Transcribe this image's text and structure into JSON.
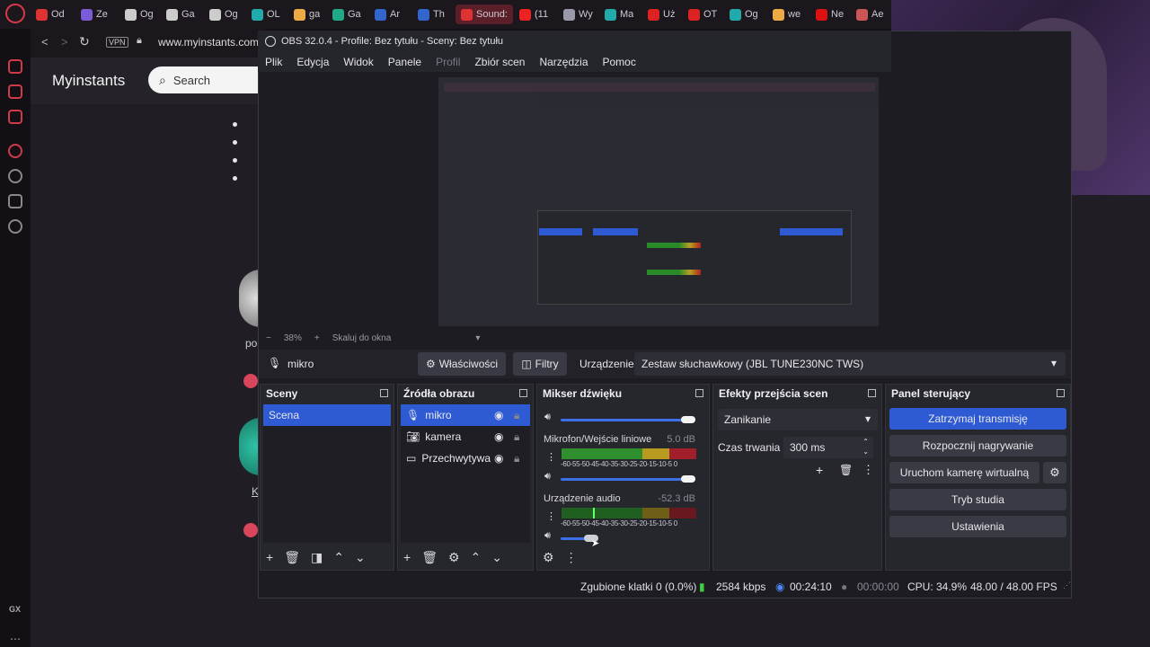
{
  "browser": {
    "tabs": [
      {
        "label": "Od",
        "color": "#d33"
      },
      {
        "label": "Ze",
        "color": "#7b5bd6"
      },
      {
        "label": "Og",
        "color": "#ccc"
      },
      {
        "label": "Ga",
        "color": "#ccc"
      },
      {
        "label": "Og",
        "color": "#ccc"
      },
      {
        "label": "OL",
        "color": "#2aa"
      },
      {
        "label": "ga",
        "color": "#ea4"
      },
      {
        "label": "Ga",
        "color": "#2a8"
      },
      {
        "label": "Ar",
        "color": "#36c"
      },
      {
        "label": "Th",
        "color": "#36c"
      },
      {
        "label": "Sound:",
        "color": "#d33"
      },
      {
        "label": "(11",
        "color": "#e22"
      },
      {
        "label": "Wy",
        "color": "#99a"
      },
      {
        "label": "Ma",
        "color": "#2aa"
      },
      {
        "label": "Uż",
        "color": "#d22"
      },
      {
        "label": "OT",
        "color": "#d22"
      },
      {
        "label": "Og",
        "color": "#2aa"
      },
      {
        "label": "we",
        "color": "#ea4"
      },
      {
        "label": "Ne",
        "color": "#d11"
      },
      {
        "label": "Ae",
        "color": "#c55"
      }
    ],
    "vpn_label": "VPN",
    "url": "www.myinstants.com/",
    "gx_label": "GX"
  },
  "site": {
    "name": "Myinstants",
    "search_placeholder": "Search",
    "partial_label_1": "po",
    "partial_label_2": "K"
  },
  "obs": {
    "title": "OBS 32.0.4 - Profile: Bez tytułu - Sceny: Bez tytułu",
    "menu": [
      "Plik",
      "Edycja",
      "Widok",
      "Panele",
      "Profil",
      "Zbiór scen",
      "Narzędzia",
      "Pomoc"
    ],
    "zoom": "38%",
    "scale_label": "Skaluj do okna",
    "source_bar": {
      "source_name": "mikro",
      "properties_label": "Właściwości",
      "filters_label": "Filtry",
      "device_label": "Urządzenie",
      "device_value": "Zestaw słuchawkowy (JBL TUNE230NC TWS)"
    },
    "scenes": {
      "title": "Sceny",
      "items": [
        "Scena"
      ]
    },
    "sources": {
      "title": "Źródła obrazu",
      "items": [
        "mikro",
        "kamera",
        "Przechwytywa"
      ]
    },
    "mixer": {
      "title": "Mikser dźwięku",
      "channels": [
        {
          "name": "Mikrofon/Wejście liniowe",
          "db": "5.0 dB",
          "level": 1.0
        },
        {
          "name": "Urządzenie audio",
          "db": "-52.3 dB",
          "level": 0.2
        }
      ],
      "scale": "-60-55-50-45-40-35-30-25-20-15-10-5 0"
    },
    "transitions": {
      "title": "Efekty przejścia scen",
      "selected": "Zanikanie",
      "duration_label": "Czas trwania",
      "duration_value": "300 ms"
    },
    "controls": {
      "title": "Panel sterujący",
      "buttons": [
        "Zatrzymaj transmisję",
        "Rozpocznij nagrywanie",
        "Uruchom kamerę wirtualną",
        "Tryb studia",
        "Ustawienia"
      ]
    },
    "status": {
      "dropped": "Zgubione klatki 0 (0.0%)",
      "bitrate": "2584 kbps",
      "stream_time": "00:24:10",
      "rec_time": "00:00:00",
      "cpu": "CPU: 34.9%",
      "fps": "48.00 / 48.00 FPS"
    }
  }
}
